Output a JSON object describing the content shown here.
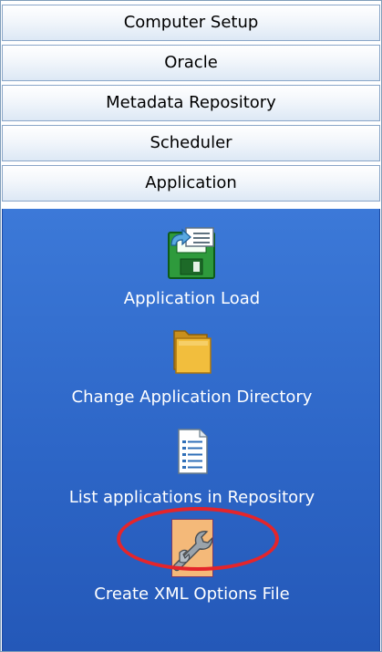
{
  "sections": [
    {
      "label": "Computer Setup"
    },
    {
      "label": "Oracle"
    },
    {
      "label": "Metadata Repository"
    },
    {
      "label": "Scheduler"
    },
    {
      "label": "Application"
    }
  ],
  "application_items": [
    {
      "label": "Application Load",
      "icon": "application-load-icon"
    },
    {
      "label": "Change Application Directory",
      "icon": "folder-icon"
    },
    {
      "label": "List applications in Repository",
      "icon": "document-list-icon"
    },
    {
      "label": "Create XML Options File",
      "icon": "wrench-icon"
    }
  ],
  "colors": {
    "content_background": "#2d66c7",
    "selected_item_background": "#f4b979",
    "highlight_ellipse": "#e4252b"
  }
}
